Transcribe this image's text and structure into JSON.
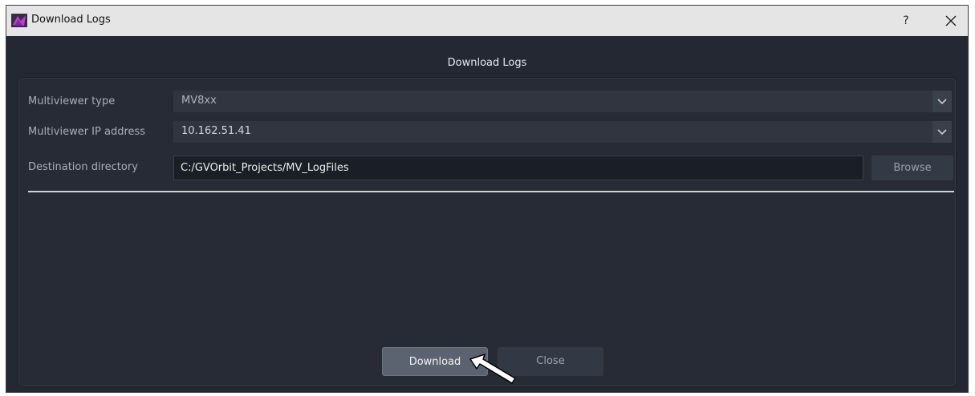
{
  "window": {
    "title": "Download Logs",
    "help_label": "?",
    "icons": {
      "app": "gvorbit-app-icon",
      "close": "close-icon"
    }
  },
  "dialog": {
    "heading": "Download Logs"
  },
  "form": {
    "multiviewer_type": {
      "label": "Multiviewer type",
      "value": "MV8xx"
    },
    "multiviewer_ip": {
      "label": "Multiviewer IP address",
      "value": "10.162.51.41"
    },
    "destination": {
      "label": "Destination directory",
      "value": "C:/GVOrbit_Projects/MV_LogFiles",
      "browse_label": "Browse"
    }
  },
  "buttons": {
    "download_label": "Download",
    "close_label": "Close"
  },
  "colors": {
    "background": "#232833",
    "titlebar": "#e5e5e5",
    "button_primary": "#5c6370"
  }
}
